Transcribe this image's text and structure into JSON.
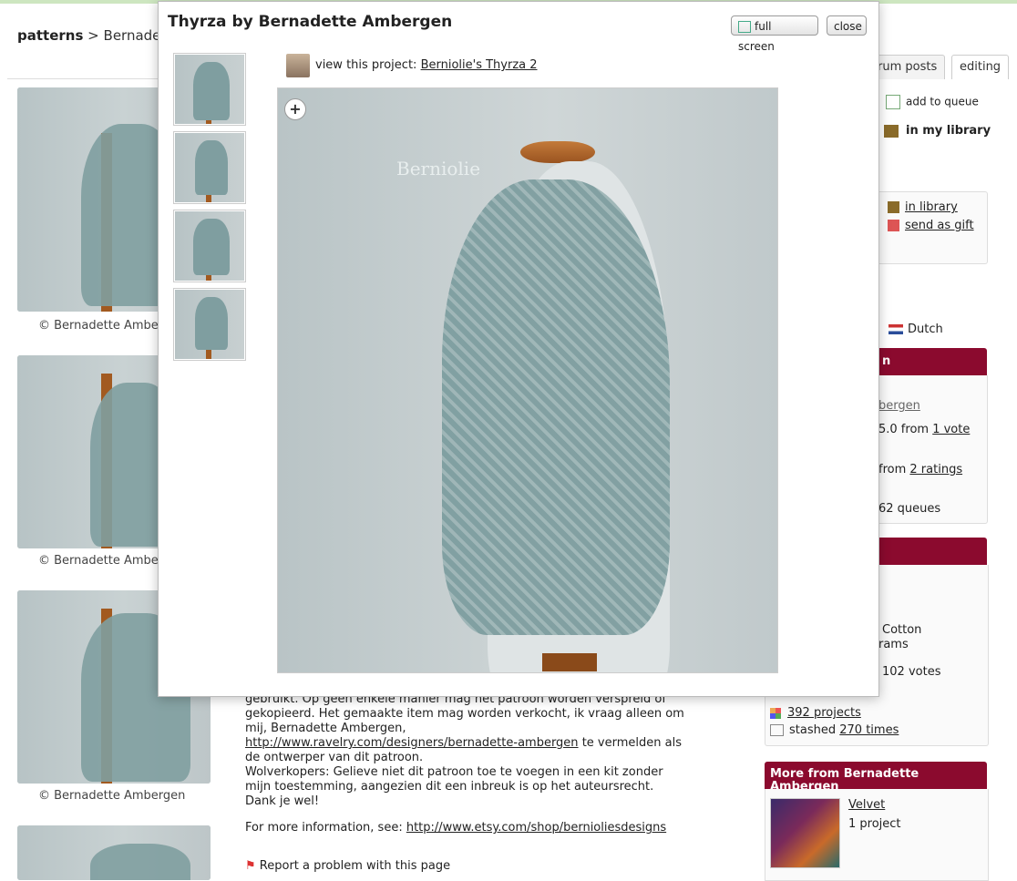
{
  "breadcrumb": {
    "root": "patterns",
    "sep": ">",
    "current": "Bernadett"
  },
  "captions": [
    "© Bernadette Amber",
    "© Bernadette Ambe",
    "© Bernadette Ambergen"
  ],
  "tabs": [
    "rum posts",
    "editing"
  ],
  "sidebar": {
    "add_to_queue": "add to queue",
    "in_my_library": "in my library",
    "in_library": "in library",
    "send_as_gift": "send as gift",
    "language": "Dutch",
    "red_header_1": "n",
    "designer_link": "bergen",
    "rating_text": "5.0 from",
    "rating_link": "1 vote",
    "difficulty_text": "from",
    "difficulty_link": "2 ratings",
    "queues": "62 queues",
    "yarn_1": "Cotton",
    "yarn_2": "rams",
    "votes": "102 votes",
    "projects_link": "392 projects",
    "stashed_prefix": "stashed",
    "stashed_link": "270 times",
    "more_from_header": "More from Bernadette Ambergen",
    "more_item_title": "Velvet",
    "more_item_projects": "1 project"
  },
  "body": {
    "line_partial": "gebruikt. Op geen enkele manier mag het patroon worden verspreid of",
    "line1": "gekopieerd. Het gemaakte item mag worden verkocht, ik vraag alleen om",
    "line2": "mij, Bernadette Ambergen,",
    "link1": "http://www.ravelry.com/designers/bernadette-ambergen",
    "line3_suffix": "te vermelden als",
    "line4": "de ontwerper van dit patroon.",
    "line5": "Wolverkopers: Gelieve niet dit patroon toe te voegen in een kit zonder",
    "line6": "mijn toestemming, aangezien dit een inbreuk is op het auteursrecht.",
    "line7": "Dank je wel!",
    "more_info_prefix": "For more information, see:",
    "more_info_link": "http://www.etsy.com/shop/bernioliesdesigns",
    "report": "Report a problem with this page"
  },
  "modal": {
    "title": "Thyrza by Bernadette Ambergen",
    "full_screen": "full screen",
    "close": "close",
    "view_prefix": "view this project:",
    "project_link": "Berniolie's Thyrza 2",
    "watermark": "Berniolie",
    "zoom": "+"
  }
}
